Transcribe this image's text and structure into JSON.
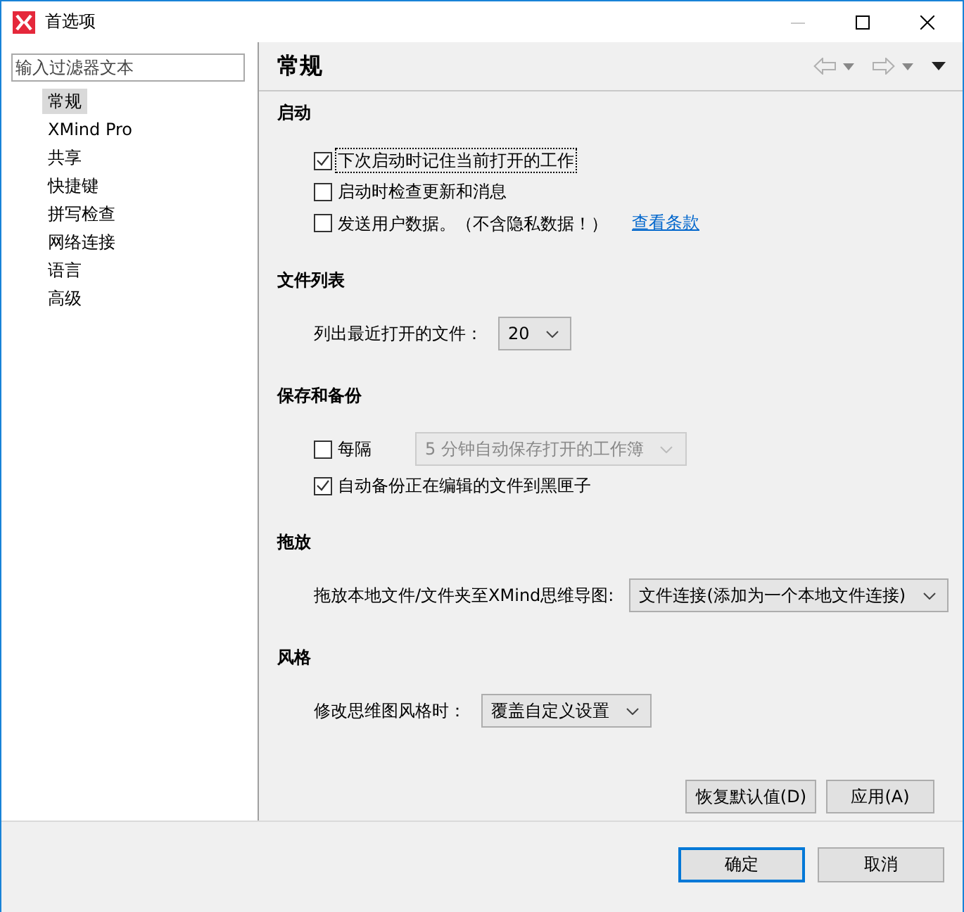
{
  "window": {
    "title": "首选项"
  },
  "filter": {
    "placeholder": "输入过滤器文本"
  },
  "nav": [
    {
      "label": "常规",
      "selected": true
    },
    {
      "label": "XMind Pro",
      "selected": false
    },
    {
      "label": "共享",
      "selected": false
    },
    {
      "label": "快捷键",
      "selected": false
    },
    {
      "label": "拼写检查",
      "selected": false
    },
    {
      "label": "网络连接",
      "selected": false
    },
    {
      "label": "语言",
      "selected": false
    },
    {
      "label": "高级",
      "selected": false
    }
  ],
  "page": {
    "title": "常规"
  },
  "sections": [
    {
      "title": "启动",
      "rows": [
        {
          "kind": "checkbox",
          "label": "下次启动时记住当前打开的工作",
          "checked": true,
          "focused": true
        },
        {
          "kind": "checkbox",
          "label": "启动时检查更新和消息",
          "checked": false,
          "focused": false
        },
        {
          "kind": "checkbox",
          "label": "发送用户数据。（不含隐私数据！）",
          "checked": false,
          "focused": false,
          "link": "查看条款"
        }
      ]
    },
    {
      "title": "文件列表",
      "rows": [
        {
          "kind": "select",
          "label": "列出最近打开的文件：",
          "value": "20",
          "disabled": false
        }
      ]
    },
    {
      "title": "保存和备份",
      "rows": [
        {
          "kind": "checkbox-select",
          "label": "每隔",
          "checked": false,
          "value": "5  分钟自动保存打开的工作簿",
          "disabled": true
        },
        {
          "kind": "checkbox",
          "label": "自动备份正在编辑的文件到黑匣子",
          "checked": true,
          "focused": false
        }
      ]
    },
    {
      "title": "拖放",
      "rows": [
        {
          "kind": "select",
          "label": "拖放本地文件/文件夹至XMind思维导图:",
          "value": "文件连接(添加为一个本地文件连接)",
          "disabled": false
        }
      ]
    },
    {
      "title": "风格",
      "rows": [
        {
          "kind": "select",
          "label": "修改思维图风格时：",
          "value": "覆盖自定义设置",
          "disabled": false
        }
      ]
    }
  ],
  "page_buttons": [
    "恢复默认值(D)",
    "应用(A)"
  ],
  "dialog_buttons": [
    {
      "label": "确定",
      "default": true
    },
    {
      "label": "取消",
      "default": false
    }
  ]
}
